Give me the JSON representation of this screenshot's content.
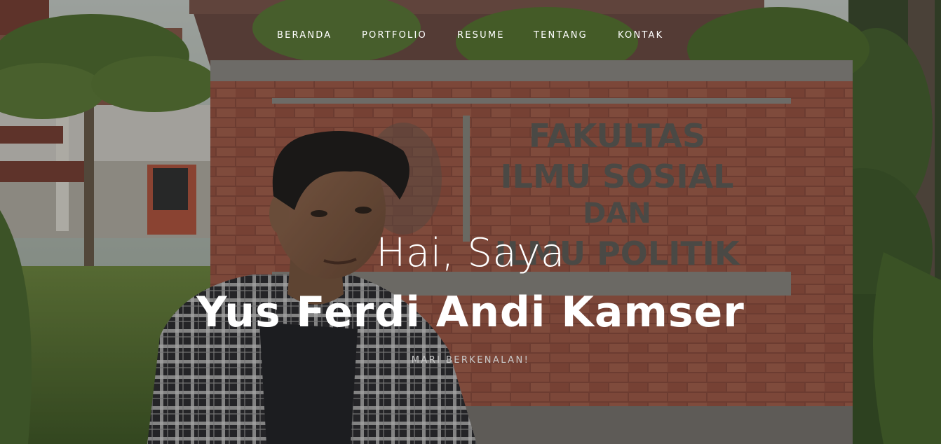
{
  "nav": {
    "items": [
      {
        "label": "BERANDA"
      },
      {
        "label": "PORTFOLIO"
      },
      {
        "label": "RESUME"
      },
      {
        "label": "TENTANG"
      },
      {
        "label": "KONTAK"
      }
    ]
  },
  "hero": {
    "greeting": "Hai, Saya",
    "name": "Yus Ferdi Andi Kamser",
    "tagline": "MARI BERKENALAN!",
    "sign_lines": [
      "FAKULTAS",
      "ILMU SOSIAL",
      "DAN",
      "ILMU POLITIK"
    ]
  }
}
